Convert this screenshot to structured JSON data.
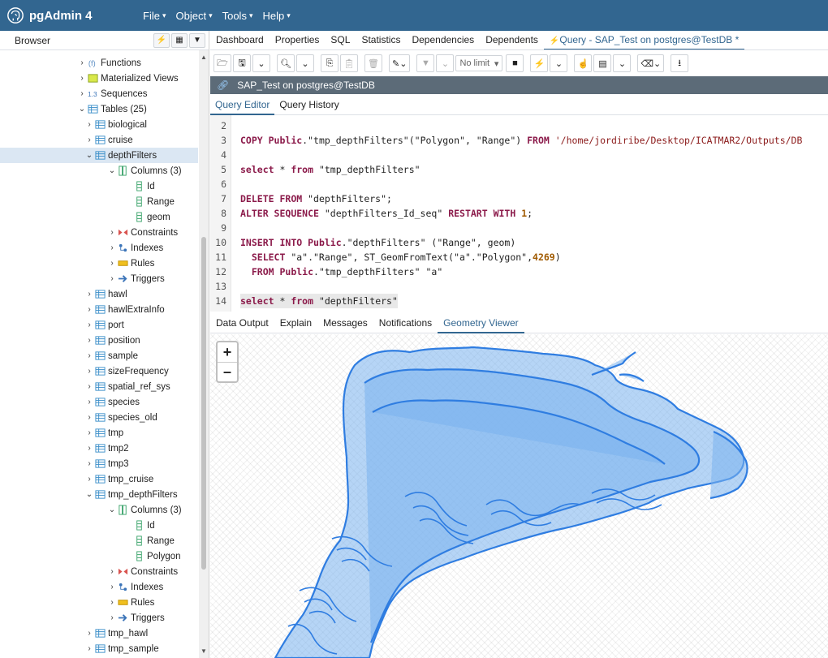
{
  "app": {
    "name": "pgAdmin 4"
  },
  "menu": [
    {
      "label": "File"
    },
    {
      "label": "Object"
    },
    {
      "label": "Tools"
    },
    {
      "label": "Help"
    }
  ],
  "browser": {
    "title": "Browser",
    "tree": [
      {
        "label": "Functions",
        "level": 1,
        "toggle": "closed",
        "icon": "function-icon"
      },
      {
        "label": "Materialized Views",
        "level": 1,
        "toggle": "closed",
        "icon": "materialized-view-icon"
      },
      {
        "label": "Sequences",
        "level": 1,
        "toggle": "closed",
        "icon": "sequence-icon"
      },
      {
        "label": "Tables (25)",
        "level": 1,
        "toggle": "open",
        "icon": "tables-icon"
      },
      {
        "label": "biological",
        "level": 2,
        "toggle": "closed",
        "icon": "table-icon"
      },
      {
        "label": "cruise",
        "level": 2,
        "toggle": "closed",
        "icon": "table-icon"
      },
      {
        "label": "depthFilters",
        "level": 2,
        "toggle": "open",
        "icon": "table-icon",
        "selected": true
      },
      {
        "label": "Columns (3)",
        "level": 3,
        "toggle": "open",
        "icon": "columns-icon"
      },
      {
        "label": "Id",
        "level": 4,
        "toggle": "none",
        "icon": "column-icon"
      },
      {
        "label": "Range",
        "level": 4,
        "toggle": "none",
        "icon": "column-icon"
      },
      {
        "label": "geom",
        "level": 4,
        "toggle": "none",
        "icon": "column-icon"
      },
      {
        "label": "Constraints",
        "level": 3,
        "toggle": "closed",
        "icon": "constraints-icon"
      },
      {
        "label": "Indexes",
        "level": 3,
        "toggle": "closed",
        "icon": "indexes-icon"
      },
      {
        "label": "Rules",
        "level": 3,
        "toggle": "closed",
        "icon": "rules-icon"
      },
      {
        "label": "Triggers",
        "level": 3,
        "toggle": "closed",
        "icon": "triggers-icon"
      },
      {
        "label": "hawl",
        "level": 2,
        "toggle": "closed",
        "icon": "table-icon"
      },
      {
        "label": "hawlExtraInfo",
        "level": 2,
        "toggle": "closed",
        "icon": "table-icon"
      },
      {
        "label": "port",
        "level": 2,
        "toggle": "closed",
        "icon": "table-icon"
      },
      {
        "label": "position",
        "level": 2,
        "toggle": "closed",
        "icon": "table-icon"
      },
      {
        "label": "sample",
        "level": 2,
        "toggle": "closed",
        "icon": "table-icon"
      },
      {
        "label": "sizeFrequency",
        "level": 2,
        "toggle": "closed",
        "icon": "table-icon"
      },
      {
        "label": "spatial_ref_sys",
        "level": 2,
        "toggle": "closed",
        "icon": "table-icon"
      },
      {
        "label": "species",
        "level": 2,
        "toggle": "closed",
        "icon": "table-icon"
      },
      {
        "label": "species_old",
        "level": 2,
        "toggle": "closed",
        "icon": "table-icon"
      },
      {
        "label": "tmp",
        "level": 2,
        "toggle": "closed",
        "icon": "table-icon"
      },
      {
        "label": "tmp2",
        "level": 2,
        "toggle": "closed",
        "icon": "table-icon"
      },
      {
        "label": "tmp3",
        "level": 2,
        "toggle": "closed",
        "icon": "table-icon"
      },
      {
        "label": "tmp_cruise",
        "level": 2,
        "toggle": "closed",
        "icon": "table-icon"
      },
      {
        "label": "tmp_depthFilters",
        "level": 2,
        "toggle": "open",
        "icon": "table-icon"
      },
      {
        "label": "Columns (3)",
        "level": 3,
        "toggle": "open",
        "icon": "columns-icon"
      },
      {
        "label": "Id",
        "level": 4,
        "toggle": "none",
        "icon": "column-icon"
      },
      {
        "label": "Range",
        "level": 4,
        "toggle": "none",
        "icon": "column-icon"
      },
      {
        "label": "Polygon",
        "level": 4,
        "toggle": "none",
        "icon": "column-icon"
      },
      {
        "label": "Constraints",
        "level": 3,
        "toggle": "closed",
        "icon": "constraints-icon"
      },
      {
        "label": "Indexes",
        "level": 3,
        "toggle": "closed",
        "icon": "indexes-icon"
      },
      {
        "label": "Rules",
        "level": 3,
        "toggle": "closed",
        "icon": "rules-icon"
      },
      {
        "label": "Triggers",
        "level": 3,
        "toggle": "closed",
        "icon": "triggers-icon"
      },
      {
        "label": "tmp_hawl",
        "level": 2,
        "toggle": "closed",
        "icon": "table-icon"
      },
      {
        "label": "tmp_sample",
        "level": 2,
        "toggle": "closed",
        "icon": "table-icon"
      }
    ]
  },
  "tabs": [
    {
      "label": "Dashboard"
    },
    {
      "label": "Properties"
    },
    {
      "label": "SQL"
    },
    {
      "label": "Statistics"
    },
    {
      "label": "Dependencies"
    },
    {
      "label": "Dependents"
    },
    {
      "label": "Query - SAP_Test on postgres@TestDB *",
      "active": true
    }
  ],
  "toolbar": {
    "limit_label": "No limit"
  },
  "connection": {
    "label": "SAP_Test on postgres@TestDB"
  },
  "editor_tabs": [
    {
      "label": "Query Editor",
      "active": true
    },
    {
      "label": "Query History"
    }
  ],
  "code_lines": [
    {
      "n": "2",
      "tokens": []
    },
    {
      "n": "3",
      "tokens": [
        {
          "t": "COPY ",
          "c": "kw"
        },
        {
          "t": "Public",
          "c": "kw"
        },
        {
          "t": ".\"tmp_depthFilters\"(\"Polygon\", \"Range\") ",
          "c": "plain"
        },
        {
          "t": "FROM ",
          "c": "kw"
        },
        {
          "t": "'/home/jordiribe/Desktop/ICATMAR2/Outputs/DB",
          "c": "str"
        }
      ]
    },
    {
      "n": "4",
      "tokens": []
    },
    {
      "n": "5",
      "tokens": [
        {
          "t": "select ",
          "c": "kw"
        },
        {
          "t": "* ",
          "c": "plain"
        },
        {
          "t": "from ",
          "c": "kw"
        },
        {
          "t": "\"tmp_depthFilters\"",
          "c": "plain"
        }
      ]
    },
    {
      "n": "6",
      "tokens": []
    },
    {
      "n": "7",
      "tokens": [
        {
          "t": "DELETE ",
          "c": "kw"
        },
        {
          "t": "FROM ",
          "c": "kw"
        },
        {
          "t": "\"depthFilters\";",
          "c": "plain"
        }
      ]
    },
    {
      "n": "8",
      "tokens": [
        {
          "t": "ALTER ",
          "c": "kw"
        },
        {
          "t": "SEQUENCE ",
          "c": "kw"
        },
        {
          "t": "\"depthFilters_Id_seq\" ",
          "c": "plain"
        },
        {
          "t": "RESTART ",
          "c": "kw"
        },
        {
          "t": "WITH ",
          "c": "kw"
        },
        {
          "t": "1",
          "c": "num"
        },
        {
          "t": ";",
          "c": "plain"
        }
      ]
    },
    {
      "n": "9",
      "tokens": []
    },
    {
      "n": "10",
      "tokens": [
        {
          "t": "INSERT ",
          "c": "kw"
        },
        {
          "t": "INTO ",
          "c": "kw"
        },
        {
          "t": "Public",
          "c": "kw"
        },
        {
          "t": ".\"depthFilters\" (\"Range\", geom)",
          "c": "plain"
        }
      ]
    },
    {
      "n": "11",
      "tokens": [
        {
          "t": "  SELECT ",
          "c": "kw"
        },
        {
          "t": "\"a\".\"Range\", ST_GeomFromText(\"a\".\"Polygon\",",
          "c": "plain"
        },
        {
          "t": "4269",
          "c": "num"
        },
        {
          "t": ")",
          "c": "plain"
        }
      ]
    },
    {
      "n": "12",
      "tokens": [
        {
          "t": "  FROM ",
          "c": "kw"
        },
        {
          "t": "Public",
          "c": "kw"
        },
        {
          "t": ".\"tmp_depthFilters\" \"a\"",
          "c": "plain"
        }
      ]
    },
    {
      "n": "13",
      "tokens": []
    },
    {
      "n": "14",
      "tokens": [
        {
          "t": "select ",
          "c": "kw"
        },
        {
          "t": "* ",
          "c": "plain"
        },
        {
          "t": "from ",
          "c": "kw"
        },
        {
          "t": "\"depthFilters\"",
          "c": "plain"
        }
      ],
      "highlight": true
    }
  ],
  "output_tabs": [
    {
      "label": "Data Output"
    },
    {
      "label": "Explain"
    },
    {
      "label": "Messages"
    },
    {
      "label": "Notifications"
    },
    {
      "label": "Geometry Viewer",
      "active": true
    }
  ],
  "map": {
    "zoom_in": "+",
    "zoom_out": "–",
    "fill": "#7ab2ef",
    "stroke": "#2f7de1"
  },
  "colors": {
    "brand": "#326690",
    "accent": "#326690",
    "selected_row": "#dbe7f3"
  }
}
